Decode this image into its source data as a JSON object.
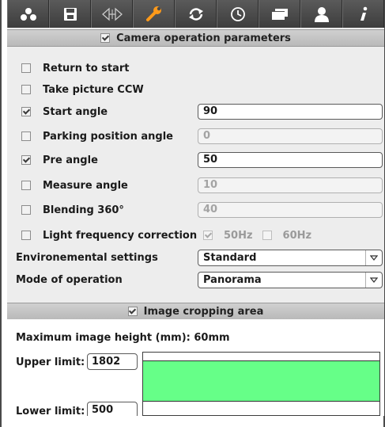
{
  "toolbar": {
    "buttons": [
      {
        "icon": "network-icon"
      },
      {
        "icon": "save-icon"
      },
      {
        "icon": "calibration-icon"
      },
      {
        "icon": "wrench-icon",
        "active": true
      },
      {
        "icon": "sync-icon"
      },
      {
        "icon": "clock-icon"
      },
      {
        "icon": "window-icon"
      },
      {
        "icon": "user-icon"
      },
      {
        "icon": "info-icon"
      }
    ],
    "accent_color": "#ff9a1a"
  },
  "camera_section": {
    "title": "Camera operation parameters",
    "enabled": true,
    "rows": [
      {
        "label": "Return to start",
        "checked": false
      },
      {
        "label": "Take picture CCW",
        "checked": false
      },
      {
        "label": "Start angle",
        "checked": true,
        "value": "90"
      },
      {
        "label": "Parking position angle",
        "checked": false,
        "value": "0"
      },
      {
        "label": "Pre angle",
        "checked": true,
        "value": "50"
      },
      {
        "label": "Measure angle",
        "checked": false,
        "value": "10"
      },
      {
        "label": "Blending 360°",
        "checked": false,
        "value": "40"
      },
      {
        "label": "Light frequency correction",
        "checked": false
      }
    ],
    "freq_50hz": {
      "label": "50Hz",
      "checked": true
    },
    "freq_60hz": {
      "label": "60Hz",
      "checked": false
    },
    "environmental": {
      "label": "Environemental settings",
      "value": "Standard"
    },
    "mode": {
      "label": "Mode of operation",
      "value": "Panorama"
    }
  },
  "crop_section": {
    "title": "Image cropping area",
    "enabled": true,
    "max_height_label": "Maximum image height (mm): 60mm",
    "upper_limit": {
      "label": "Upper limit:",
      "value": "1802"
    },
    "lower_limit": {
      "label": "Lower limit:",
      "value": "500"
    },
    "crop_color": "#66ff88"
  }
}
